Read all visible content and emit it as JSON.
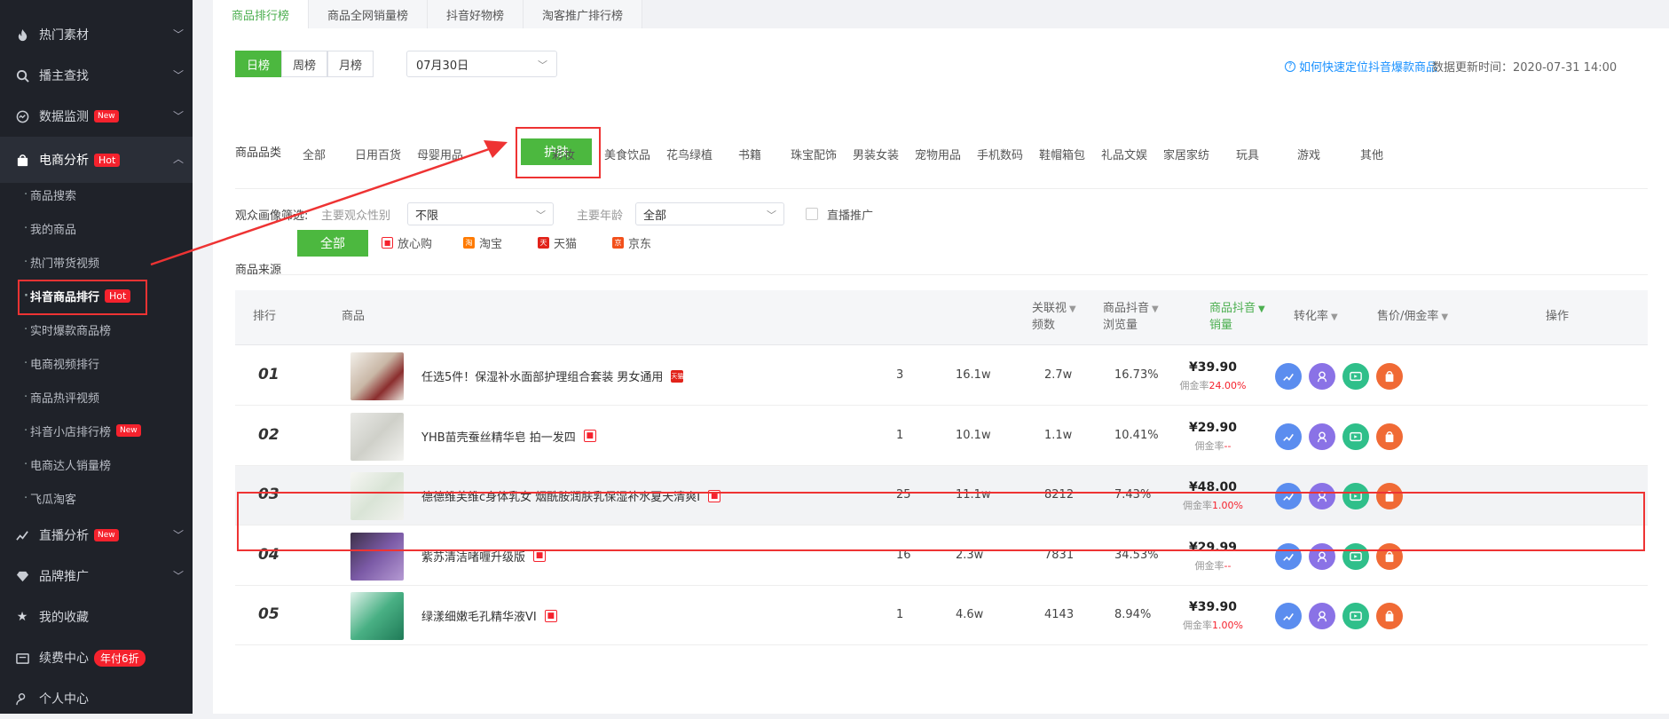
{
  "sidebar": {
    "items": [
      {
        "label": "热门素材",
        "icon": "fire-icon"
      },
      {
        "label": "播主查找",
        "icon": "search-icon"
      },
      {
        "label": "数据监测",
        "icon": "monitor-icon",
        "badge": "New"
      },
      {
        "label": "电商分析",
        "icon": "shopping-bag-icon",
        "badge": "Hot"
      },
      {
        "label": "直播分析",
        "icon": "live-chart-icon",
        "badge": "New"
      },
      {
        "label": "品牌推广",
        "icon": "diamond-icon"
      },
      {
        "label": "我的收藏",
        "icon": "star-icon"
      },
      {
        "label": "续费中心",
        "icon": "wallet-icon",
        "badge": "年付6折"
      },
      {
        "label": "个人中心",
        "icon": "user-icon"
      }
    ],
    "sub_items": [
      {
        "label": "商品搜索"
      },
      {
        "label": "我的商品"
      },
      {
        "label": "热门带货视频"
      },
      {
        "label": "抖音商品排行",
        "badge": "Hot"
      },
      {
        "label": "实时爆款商品榜"
      },
      {
        "label": "电商视频排行"
      },
      {
        "label": "商品热评视频"
      },
      {
        "label": "抖音小店排行榜",
        "badge": "New"
      },
      {
        "label": "电商达人销量榜"
      },
      {
        "label": "飞瓜淘客"
      }
    ]
  },
  "tabs": [
    "商品排行榜",
    "商品全网销量榜",
    "抖音好物榜",
    "淘客推广排行榜"
  ],
  "period_buttons": [
    "日榜",
    "周榜",
    "月榜"
  ],
  "date_value": "07月30日",
  "help_link": "如何快速定位抖音爆款商品",
  "update_time": "数据更新时间：2020-07-31 14:00",
  "category": {
    "label": "商品品类",
    "items": [
      "全部",
      "日用百货",
      "母婴用品",
      "护肤",
      "彩妆",
      "美食饮品",
      "花鸟绿植",
      "书籍",
      "珠宝配饰",
      "男装女装",
      "宠物用品",
      "手机数码",
      "鞋帽箱包",
      "礼品文娱",
      "家居家纺",
      "玩具",
      "游戏",
      "其他"
    ],
    "selected": "护肤"
  },
  "audience": {
    "label": "观众画像筛选:",
    "gender_label": "主要观众性别",
    "gender_value": "不限",
    "age_label": "主要年龄",
    "age_value": "全部",
    "live_label": "直播推广"
  },
  "source": {
    "label": "商品来源",
    "items": [
      "全部",
      "放心购",
      "淘宝",
      "天猫",
      "京东"
    ],
    "selected": "全部"
  },
  "table": {
    "headers": {
      "rank": "排行",
      "product": "商品",
      "videos_1": "关联视",
      "videos_2": "频数",
      "views_1": "商品抖音",
      "views_2": "浏览量",
      "sales_1": "商品抖音",
      "sales_2": "销量",
      "conv": "转化率",
      "price": "售价/佣金率",
      "ops": "操作"
    },
    "rows": [
      {
        "rank": "01",
        "name": "任选5件！保湿补水面部护理组合套装 男女通用",
        "videos": "3",
        "views": "16.1w",
        "sales": "2.7w",
        "conv": "16.73%",
        "price": "¥39.90",
        "comm_label": "佣金率",
        "comm": "24.00%",
        "mark": "tmall"
      },
      {
        "rank": "02",
        "name": "YHB苗壳蚕丝精华皂 拍一发四",
        "videos": "1",
        "views": "10.1w",
        "sales": "1.1w",
        "conv": "10.41%",
        "price": "¥29.90",
        "comm_label": "佣金率",
        "comm": "--",
        "mark": "fangxin"
      },
      {
        "rank": "03",
        "name": "德德维芙维c身体乳女 烟酰胺润肤乳保湿补水夏天清爽Ⅰ",
        "videos": "25",
        "views": "11.1w",
        "sales": "8212",
        "conv": "7.43%",
        "price": "¥48.00",
        "comm_label": "佣金率",
        "comm": "1.00%",
        "mark": "fangxin"
      },
      {
        "rank": "04",
        "name": "紫苏清洁啫喱升级版",
        "videos": "16",
        "views": "2.3w",
        "sales": "7831",
        "conv": "34.53%",
        "price": "¥29.99",
        "comm_label": "佣金率",
        "comm": "--",
        "mark": "fangxin"
      },
      {
        "rank": "05",
        "name": "绿漾细嫩毛孔精华液VI",
        "videos": "1",
        "views": "4.6w",
        "sales": "4143",
        "conv": "8.94%",
        "price": "¥39.90",
        "comm_label": "佣金率",
        "comm": "1.00%",
        "mark": "fangxin"
      }
    ]
  },
  "colors": {
    "accent": "#4cb83f",
    "highlight": "#e33333",
    "sidebar_bg": "#1f2229"
  }
}
